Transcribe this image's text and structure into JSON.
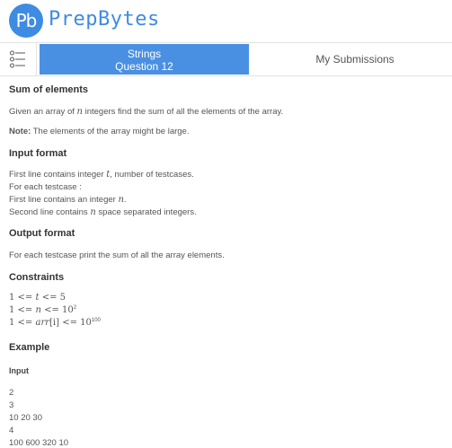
{
  "header": {
    "logo_text": "Pb",
    "brand": "PrepBytes",
    "brand_color": "#3d8be3"
  },
  "tabs": {
    "menu_icon": "list-icon",
    "active_line1": "Strings",
    "active_line2": "Question 12",
    "submissions": "My Submissions",
    "accent": "#4a90e2"
  },
  "problem": {
    "title": "Sum of elements",
    "statement_pre": "Given an array of ",
    "statement_var": "n",
    "statement_post": " integers find the sum of all the elements of the array.",
    "note_label": "Note:",
    "note_text": " The elements of the array might be large.",
    "input_heading": "Input format",
    "input_l1_pre": "First line contains integer ",
    "input_l1_var": "t",
    "input_l1_post": ", number of testcases.",
    "input_l2": "For each testcase :",
    "input_l3_pre": "First line contains an integer ",
    "input_l3_var": "n",
    "input_l3_post": ".",
    "input_l4_pre": "Second line contains ",
    "input_l4_var": "n",
    "input_l4_post": " space separated integers.",
    "output_heading": "Output format",
    "output_text": "For each testcase print the sum of all the array elements.",
    "constraints_heading": "Constraints",
    "c1": {
      "a": "1 <= ",
      "v": "t",
      "b": " <= 5"
    },
    "c2": {
      "a": "1 <= ",
      "v": "n",
      "b": " <= 10",
      "exp": "2"
    },
    "c3": {
      "a": "1 <= ",
      "v": "arr",
      "idx": "[i]",
      "b": " <= 10",
      "exp": "100"
    },
    "example_heading": "Example",
    "input_label": "Input",
    "sample_lines": [
      "2",
      "3",
      "10 20 30",
      "4",
      "100 600 320 10"
    ]
  }
}
